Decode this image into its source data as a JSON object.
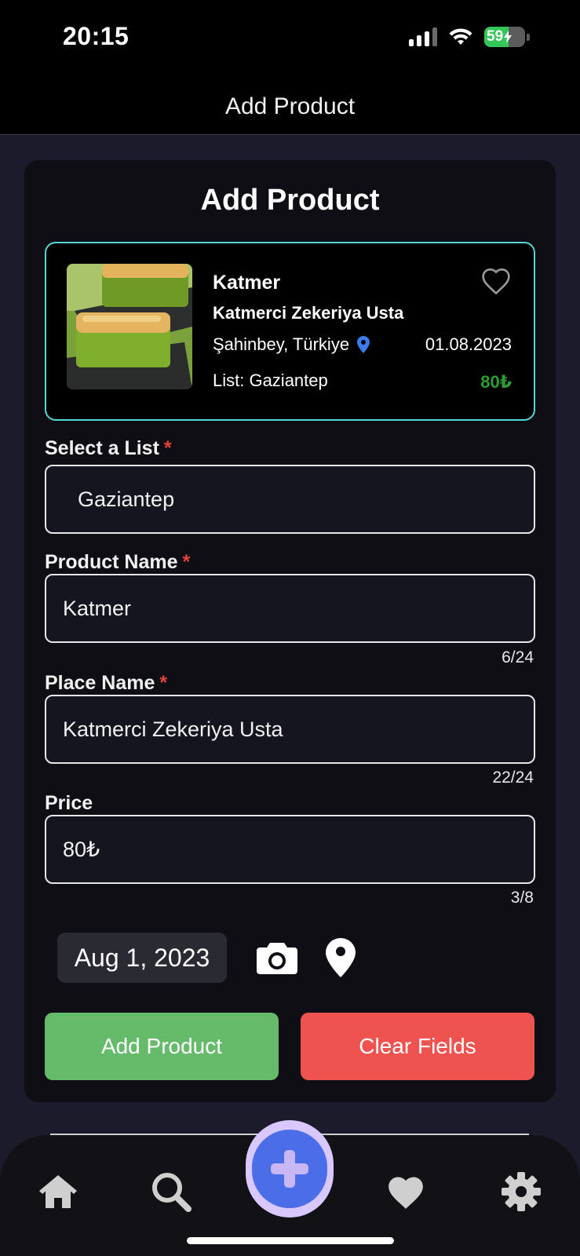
{
  "status_bar": {
    "time": "20:15",
    "battery_percent": "59"
  },
  "nav": {
    "title": "Add Product"
  },
  "card": {
    "title": "Add Product"
  },
  "preview": {
    "product_name": "Katmer",
    "place_name": "Katmerci Zekeriya Usta",
    "location": "Şahinbey, Türkiye",
    "date": "01.08.2023",
    "list_text": "List: Gaziantep",
    "price": "80₺"
  },
  "form": {
    "list": {
      "label": "Select a List",
      "required": "*",
      "value": "Gaziantep"
    },
    "product_name": {
      "label": "Product Name",
      "required": "*",
      "value": "Katmer",
      "counter": "6/24"
    },
    "place_name": {
      "label": "Place Name",
      "required": "*",
      "value": "Katmerci Zekeriya Usta",
      "counter": "22/24"
    },
    "price": {
      "label": "Price",
      "value": "80₺",
      "counter": "3/8"
    },
    "date": "Aug 1, 2023"
  },
  "buttons": {
    "add": "Add Product",
    "clear": "Clear Fields"
  },
  "colors": {
    "accent_cyan": "#54d6d3",
    "add_green": "#66bb6a",
    "clear_red": "#ef5350",
    "price_green": "#2e9c32",
    "fab_blue": "#4b6ee8"
  },
  "icons": [
    "camera-icon",
    "location-pin-icon",
    "heart-outline-icon",
    "home-icon",
    "search-icon",
    "plus-icon",
    "heart-icon",
    "gear-icon"
  ]
}
